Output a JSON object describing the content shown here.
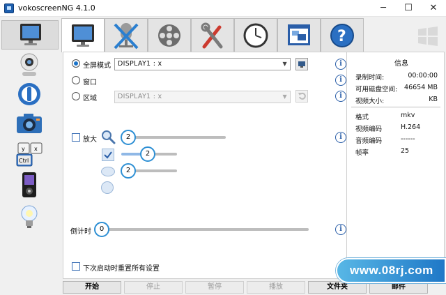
{
  "window": {
    "title": "vokoscreenNG 4.1.0",
    "minimize": "─",
    "maximize": "☐",
    "close": "✕"
  },
  "sidebar": {
    "items": [
      {
        "icon": "monitor-icon"
      },
      {
        "icon": "webcam-icon"
      },
      {
        "icon": "power-icon"
      },
      {
        "icon": "camera-icon"
      },
      {
        "icon": "keyboard-keys-icon"
      },
      {
        "icon": "media-player-icon"
      },
      {
        "icon": "lightbulb-icon"
      }
    ]
  },
  "tabs": [
    {
      "icon": "monitor-icon"
    },
    {
      "icon": "microphone-muted-icon"
    },
    {
      "icon": "film-reel-icon"
    },
    {
      "icon": "tools-icon"
    },
    {
      "icon": "clock-icon"
    },
    {
      "icon": "window-icon"
    },
    {
      "icon": "help-icon"
    }
  ],
  "screen": {
    "fullscreen_label": "全屏模式",
    "fullscreen_display": "DISPLAY1 :  x",
    "window_label": "窗口",
    "area_label": "区域",
    "area_display": "DISPLAY1 :  x"
  },
  "magnifier": {
    "label": "放大",
    "size_value": "2",
    "shape_value_1": "2",
    "shape_value_2": "2"
  },
  "countdown": {
    "label": "倒计时",
    "value": "0"
  },
  "reset_label": "下次启动时重置所有设置",
  "info": {
    "title": "信息",
    "rows_top": [
      {
        "label": "录制时间:",
        "value": "00:00:00"
      },
      {
        "label": "可用磁盘空间:",
        "value": "46654 MB"
      },
      {
        "label": "视频大小:",
        "value": "KB"
      }
    ],
    "rows_bottom": [
      {
        "label": "格式",
        "value": "mkv"
      },
      {
        "label": "视频编码",
        "value": "H.264"
      },
      {
        "label": "音频编码",
        "value": "------"
      },
      {
        "label": "帧率",
        "value": "25"
      }
    ]
  },
  "toolbar": {
    "start": "开始",
    "stop": "停止",
    "pause": "暂停",
    "play": "播放",
    "folder": "文件夹",
    "send": "邮件"
  },
  "watermark": "www.08rj.com",
  "colors": {
    "accent": "#2d8fd4",
    "info_blue": "#2a5ea8"
  }
}
